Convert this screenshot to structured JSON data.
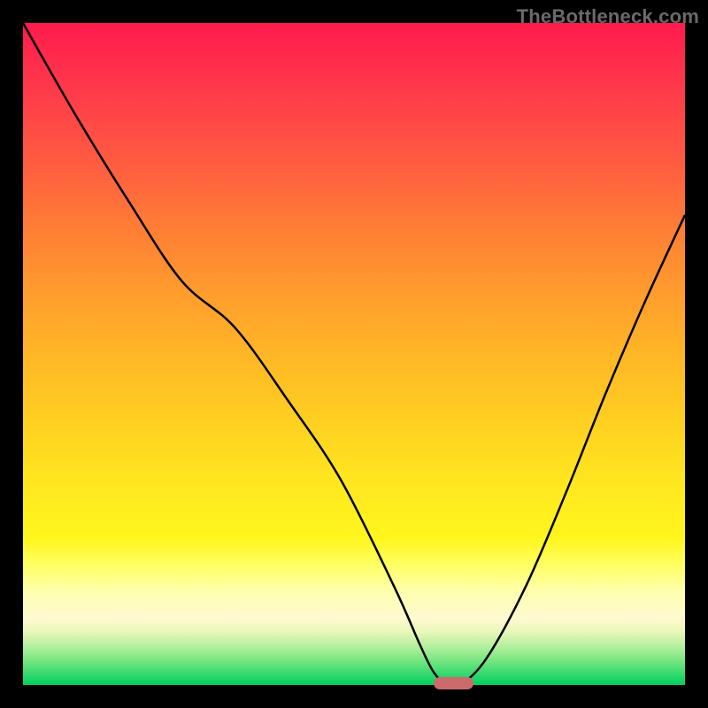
{
  "watermark": "TheBottleneck.com",
  "colors": {
    "background": "#000000",
    "curve": "#000000",
    "marker": "#cc6b6b",
    "gradient_top": "#ff1a4d",
    "gradient_bottom": "#00d060"
  },
  "chart_data": {
    "type": "line",
    "title": "",
    "xlabel": "",
    "ylabel": "",
    "xlim": [
      0,
      100
    ],
    "ylim": [
      0,
      100
    ],
    "x": [
      0,
      8,
      16,
      24,
      32,
      40,
      48,
      56,
      60,
      62,
      64,
      66,
      70,
      76,
      82,
      88,
      94,
      100
    ],
    "values": [
      100,
      86,
      73,
      61,
      54,
      43,
      31,
      15,
      6,
      2,
      0,
      0,
      4,
      15,
      29,
      44,
      58,
      71
    ],
    "marker": {
      "x_start": 62,
      "x_end": 68,
      "y": 0
    },
    "annotations": []
  }
}
